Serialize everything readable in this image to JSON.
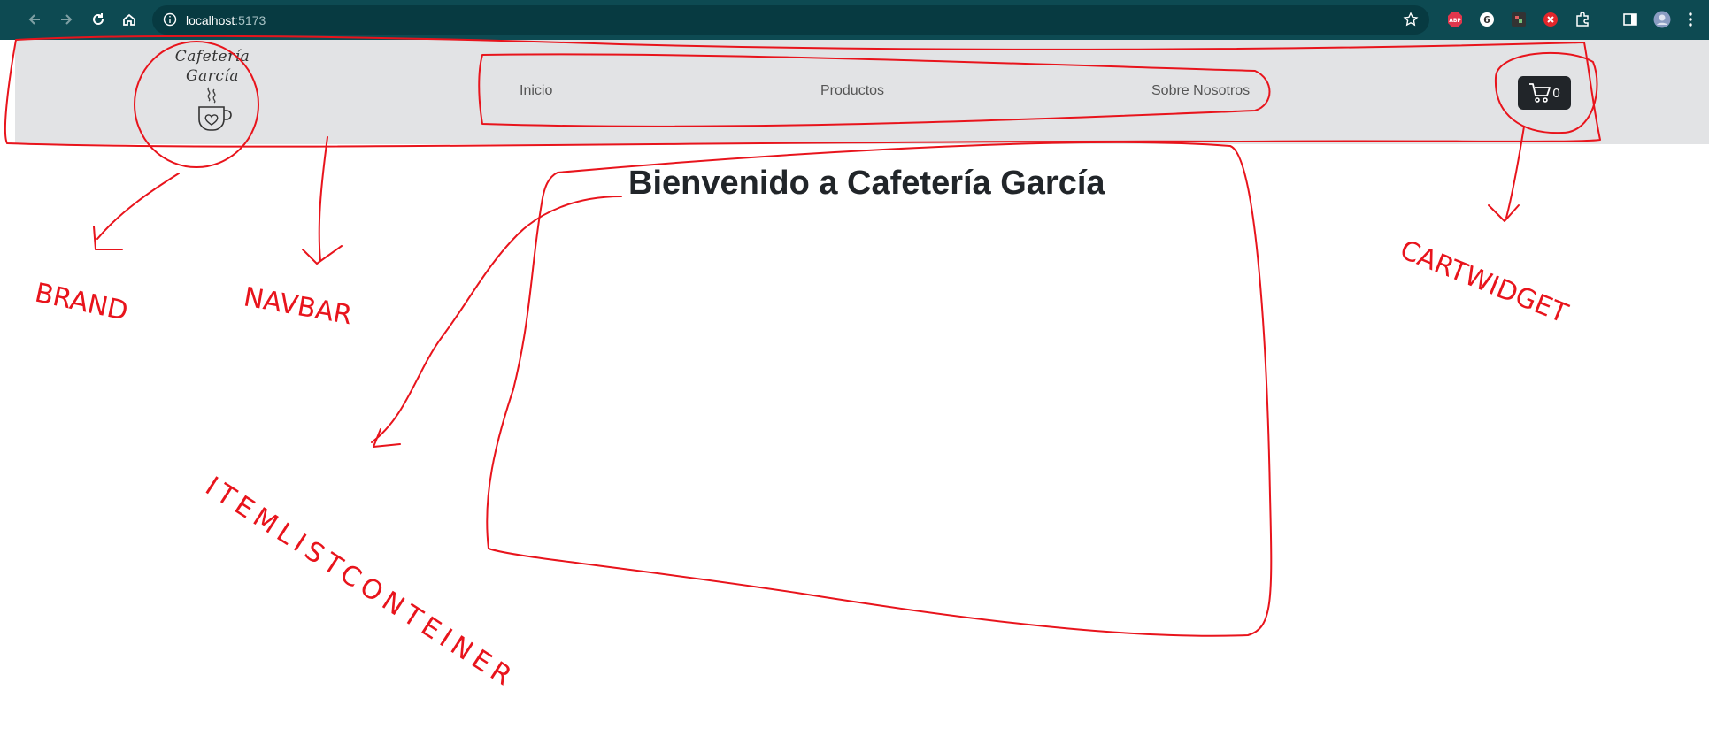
{
  "browser": {
    "url_host": "localhost",
    "url_port": ":5173",
    "extensions": [
      "adblock-plus-icon",
      "extension-6-icon",
      "extension-puzzle-dark-icon",
      "extension-x-icon",
      "extensions-puzzle-icon",
      "side-panel-icon",
      "profile-avatar-icon",
      "more-menu-icon"
    ]
  },
  "brand": {
    "line1": "Cafetería",
    "line2": "García"
  },
  "nav": {
    "items": [
      {
        "label": "Inicio"
      },
      {
        "label": "Productos"
      },
      {
        "label": "Sobre Nosotros"
      }
    ]
  },
  "cart": {
    "count": "0"
  },
  "main": {
    "title": "Bienvenido a Cafetería García"
  },
  "annotations": {
    "brand": "BRAND",
    "navbar": "NAVBAR",
    "cartwidget": "CARTWIDGET",
    "itemlist": "ITEMLISTCONTEINER",
    "color": "#e8141c"
  }
}
